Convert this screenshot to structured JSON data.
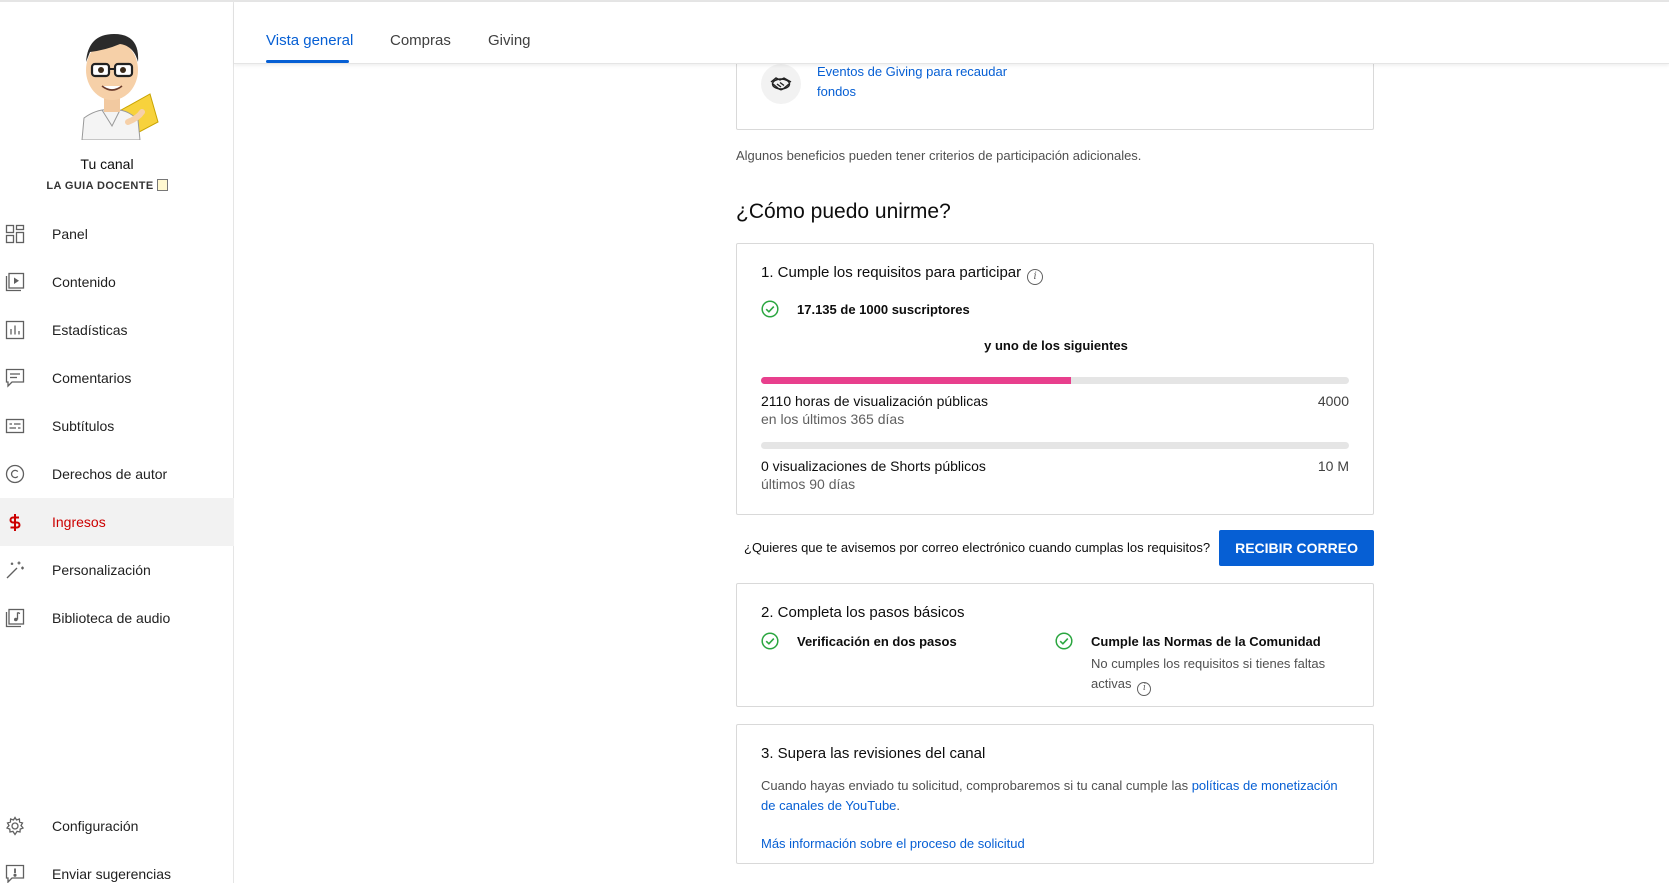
{
  "sidebar": {
    "channel_title": "Tu canal",
    "channel_name": "LA GUIA DOCENTE",
    "items": [
      {
        "label": "Panel",
        "icon": "dashboard-icon"
      },
      {
        "label": "Contenido",
        "icon": "content-icon"
      },
      {
        "label": "Estadísticas",
        "icon": "analytics-icon"
      },
      {
        "label": "Comentarios",
        "icon": "comments-icon"
      },
      {
        "label": "Subtítulos",
        "icon": "subtitles-icon"
      },
      {
        "label": "Derechos de autor",
        "icon": "copyright-icon"
      },
      {
        "label": "Ingresos",
        "icon": "dollar-icon",
        "active": true
      },
      {
        "label": "Personalización",
        "icon": "magic-wand-icon"
      },
      {
        "label": "Biblioteca de audio",
        "icon": "audio-library-icon"
      }
    ],
    "bottom_items": [
      {
        "label": "Configuración",
        "icon": "gear-icon"
      },
      {
        "label": "Enviar sugerencias",
        "icon": "feedback-icon"
      }
    ]
  },
  "tabs": [
    {
      "label": "Vista general",
      "active": true
    },
    {
      "label": "Compras"
    },
    {
      "label": "Giving"
    }
  ],
  "giving": {
    "link": "Eventos de Giving para recaudar fondos",
    "icon": "handshake-icon"
  },
  "note": "Algunos beneficios pueden tener criterios de participación adicionales.",
  "section_title": "¿Cómo puedo unirme?",
  "requirements": {
    "title": "1. Cumple los requisitos para participar",
    "subscribers": "17.135 de 1000 suscriptores",
    "or_text": "y uno de los siguientes",
    "watch_hours": {
      "label": "2110 horas de visualización públicas",
      "sub": "en los últimos 365 días",
      "target": "4000",
      "progress": 0.5275
    },
    "shorts": {
      "label": "0 visualizaciones de Shorts públicos",
      "sub": "últimos 90 días",
      "target": "10 M",
      "progress": 0
    }
  },
  "email": {
    "question": "¿Quieres que te avisemos por correo electrónico cuando cumplas los requisitos?",
    "button": "RECIBIR CORREO"
  },
  "basic_steps": {
    "title": "2. Completa los pasos básicos",
    "step1": "Verificación en dos pasos",
    "step2": "Cumple las Normas de la Comunidad",
    "step2_sub": "No cumples los requisitos si tienes faltas activas"
  },
  "review": {
    "title": "3. Supera las revisiones del canal",
    "text": "Cuando hayas enviado tu solicitud, comprobaremos si tu canal cumple las ",
    "policy_link": "políticas de monetización de canales de YouTube",
    "text_end": ".",
    "more_link": "Más información sobre el proceso de solicitud"
  },
  "colors": {
    "accent": "#065fd4",
    "active_nav": "#cc0000",
    "progress": "#e83f8d",
    "check": "#2ba640"
  }
}
